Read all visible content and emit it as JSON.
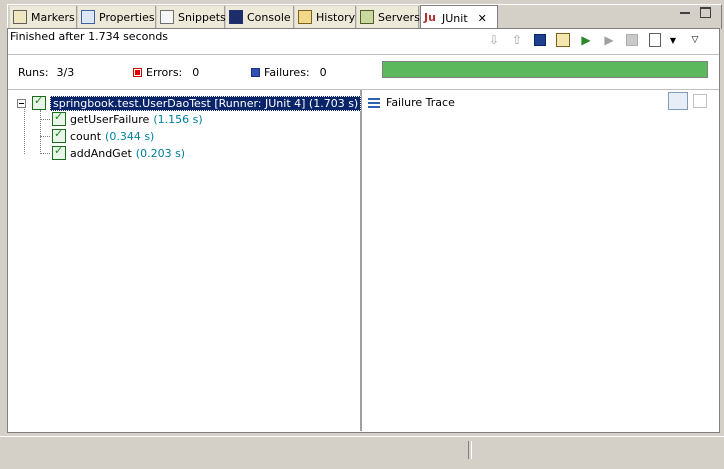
{
  "tabs": [
    {
      "label": "Markers",
      "icon": "markers-icon"
    },
    {
      "label": "Properties",
      "icon": "properties-icon"
    },
    {
      "label": "Snippets",
      "icon": "snippets-icon"
    },
    {
      "label": "Console",
      "icon": "console-icon"
    },
    {
      "label": "History",
      "icon": "history-icon"
    },
    {
      "label": "Servers",
      "icon": "servers-icon"
    },
    {
      "label": "JUnit",
      "icon": "junit-icon",
      "active": true
    }
  ],
  "status": {
    "text": "Finished after 1.734 seconds"
  },
  "counters": {
    "runs_label": "Runs:",
    "runs_value": "3/3",
    "errors_label": "Errors:",
    "errors_value": "0",
    "failures_label": "Failures:",
    "failures_value": "0",
    "progress": 1.0,
    "progress_color": "#5cb85c"
  },
  "tree": {
    "suite": {
      "label": "springbook.test.UserDaoTest [Runner: JUnit 4] (1.703 s)"
    },
    "tests": [
      {
        "name": "getUserFailure",
        "time": "(1.156 s)"
      },
      {
        "name": "count",
        "time": "(0.344 s)"
      },
      {
        "name": "addAndGet",
        "time": "(0.203 s)"
      }
    ]
  },
  "trace": {
    "title": "Failure Trace"
  }
}
